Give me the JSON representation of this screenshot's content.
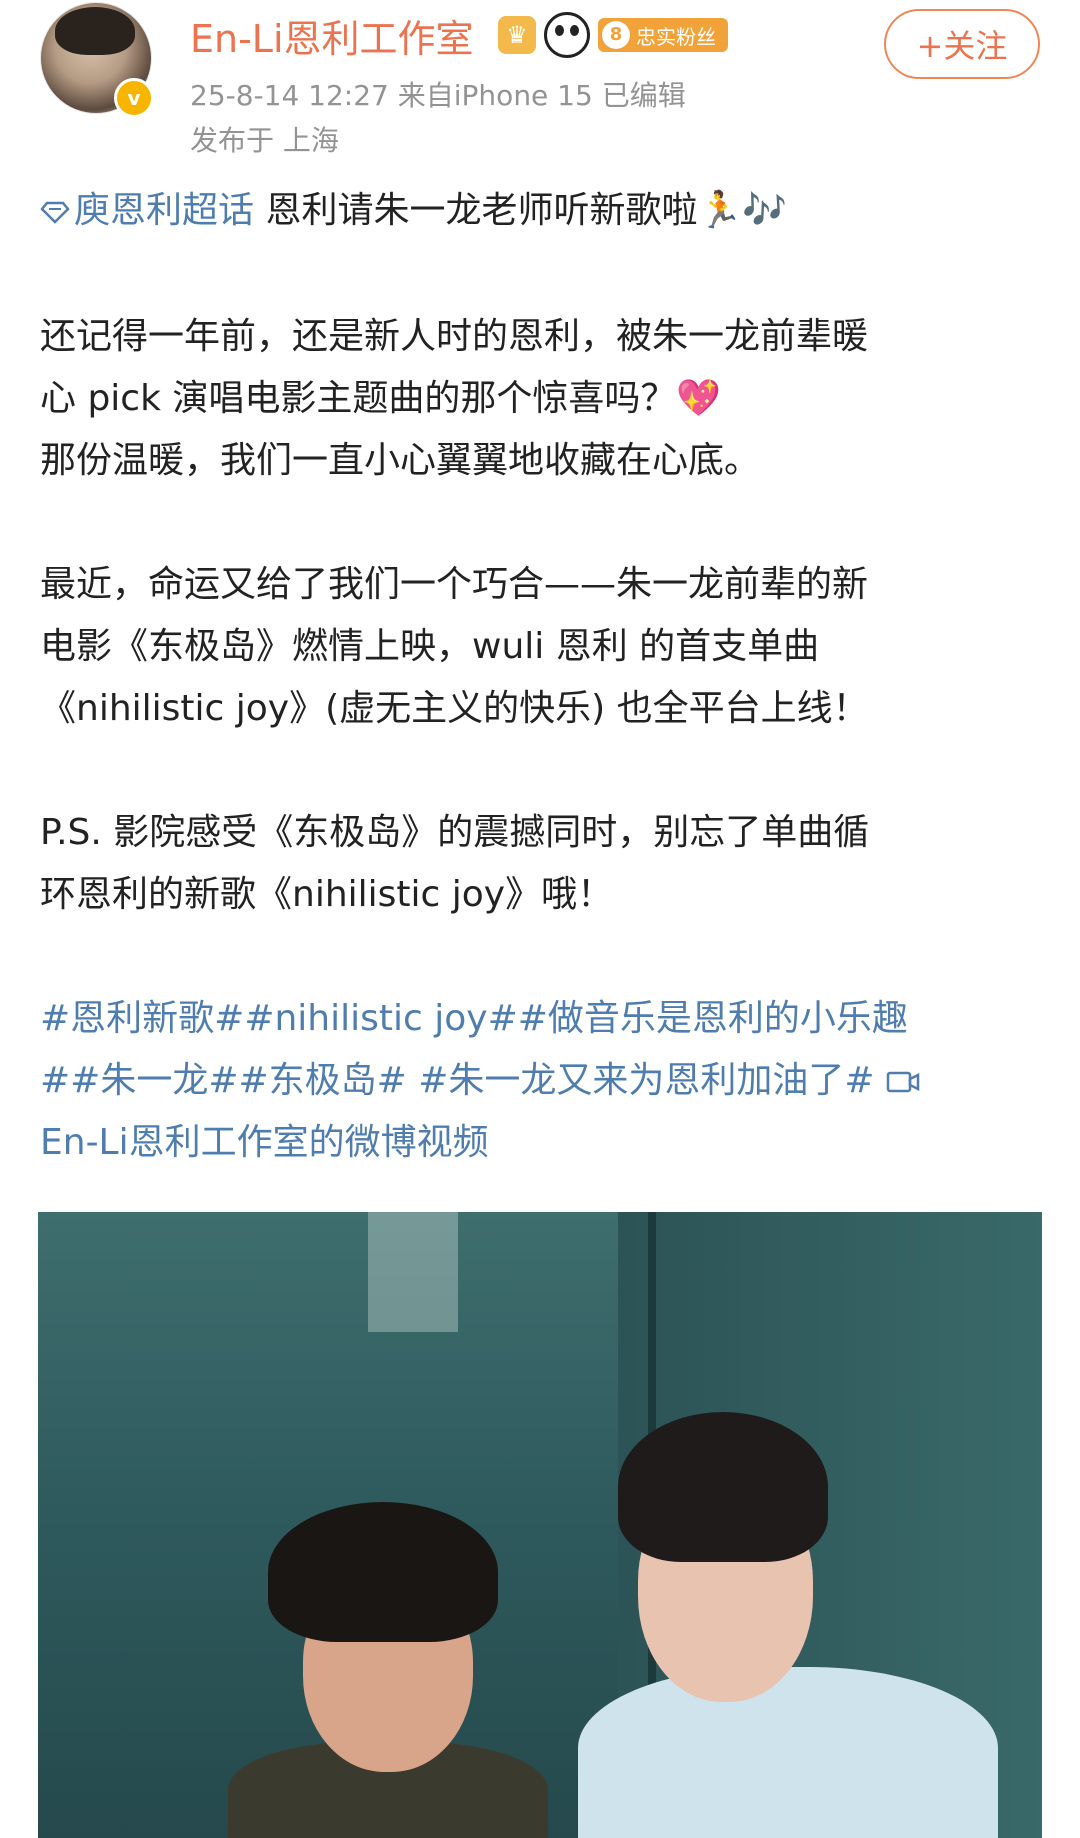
{
  "header": {
    "username": "En-Li恩利工作室",
    "fan_badge": {
      "level": "8",
      "label": "忠实粉丝"
    },
    "meta_line1": "25-8-14 12:27  来自iPhone 15  已编辑",
    "meta_line2": "发布于 上海",
    "follow_label": "+关注"
  },
  "post": {
    "topic_tag": "庾恩利超话",
    "line1_text": " 恩利请朱一龙老师听新歌啦🏃🎶",
    "para1": [
      "还记得一年前，还是新人时的恩利，被朱一龙前辈暖",
      "心 pick 演唱电影主题曲的那个惊喜吗？💖",
      "那份温暖，我们一直小心翼翼地收藏在心底。"
    ],
    "para2": [
      "最近，命运又给了我们一个巧合——朱一龙前辈的新",
      "电影《东极岛》燃情上映，wuli 恩利 的首支单曲",
      "《nihilistic joy》(虚无主义的快乐) 也全平台上线！"
    ],
    "para3": [
      "P.S. 影院感受《东极岛》的震撼同时，别忘了单曲循",
      "环恩利的新歌《nihilistic joy》哦！"
    ],
    "hashtags_line1": "#恩利新歌##nihilistic joy##做音乐是恩利的小乐趣",
    "hashtags_line2": "##朱一龙##东极岛# #朱一龙又来为恩利加油了# ",
    "video_link": "En-Li恩利工作室的微博视频"
  },
  "colors": {
    "username": "#eb7350",
    "link": "#507daf",
    "meta": "#939393"
  }
}
